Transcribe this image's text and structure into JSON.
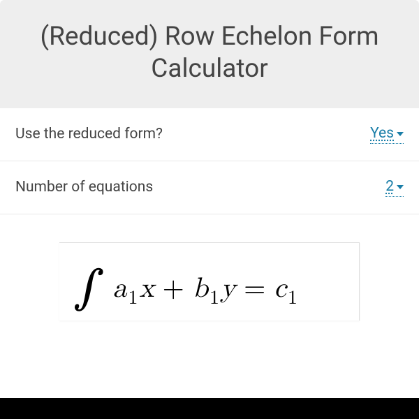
{
  "header": {
    "title": "(Reduced) Row Echelon Form Calculator"
  },
  "fields": {
    "reduced": {
      "label": "Use the reduced form?",
      "value": "Yes"
    },
    "equations": {
      "label": "Number of equations",
      "value": "2"
    }
  },
  "equation": {
    "a": "a",
    "a_sub": "1",
    "x": "x",
    "plus": "+",
    "b": "b",
    "b_sub": "1",
    "y": "y",
    "eq": "=",
    "c": "c",
    "c_sub": "1"
  }
}
